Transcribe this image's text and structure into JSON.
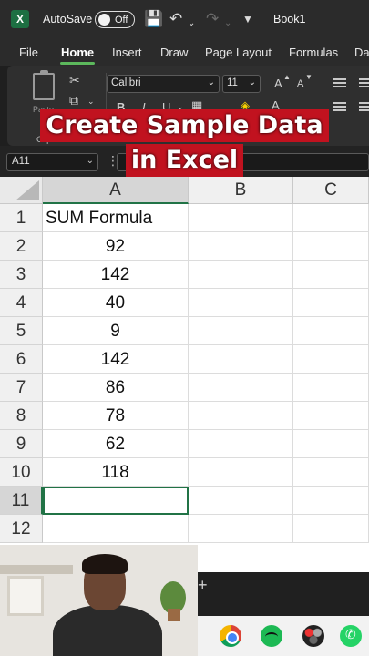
{
  "titlebar": {
    "app_logo": "X",
    "autosave_label": "AutoSave",
    "autosave_state": "Off",
    "book_title": "Book1",
    "icons": [
      "excel-logo",
      "save-icon",
      "undo-icon",
      "redo-icon",
      "customize-icon"
    ]
  },
  "tabs": [
    "File",
    "Home",
    "Insert",
    "Draw",
    "Page Layout",
    "Formulas",
    "Da"
  ],
  "active_tab": "Home",
  "ribbon": {
    "paste_label": "Paste",
    "clipboard_label": "Clip",
    "font_name": "Calibri",
    "font_size": "11",
    "bold": "B",
    "italic": "I",
    "underline": "U",
    "grow_font": "A",
    "shrink_font": "A"
  },
  "formula_bar": {
    "name_box": "A11",
    "formula": ""
  },
  "overlay": {
    "line1": "Create Sample Data",
    "line2": "in Excel"
  },
  "sheet": {
    "columns": [
      "A",
      "B",
      "C"
    ],
    "rows": [
      "1",
      "2",
      "3",
      "4",
      "5",
      "6",
      "7",
      "8",
      "9",
      "10",
      "11",
      "12"
    ],
    "col_a": [
      "SUM Formula",
      "92",
      "142",
      "40",
      "9",
      "142",
      "86",
      "78",
      "62",
      "118",
      "",
      ""
    ],
    "active_cell": "A11"
  },
  "taskbar": {
    "apps": [
      "chrome-icon",
      "spotify-icon",
      "davinci-resolve-icon",
      "whatsapp-icon"
    ]
  },
  "colors": {
    "excel_green": "#217346",
    "overlay_red": "#c1121f",
    "ribbon_bg": "#2f2f2f",
    "titlebar_bg": "#2b2b2b"
  }
}
